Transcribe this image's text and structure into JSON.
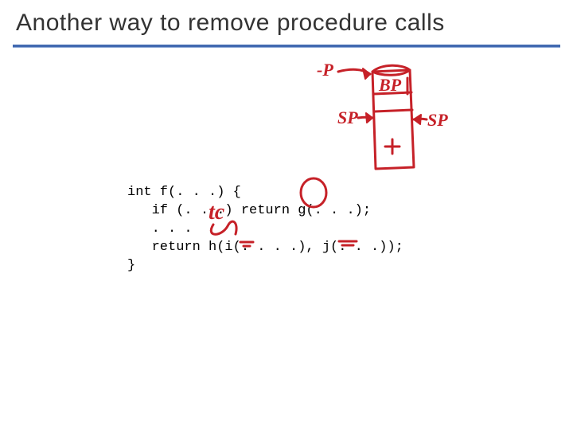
{
  "slide": {
    "title": "Another way to remove procedure calls",
    "code_lines": [
      "int f(. . .) {",
      "   if (. . .) return g(. . .);",
      "   . . .",
      "   return h(i(. . . .), j(. . .));",
      "}"
    ],
    "annotations": {
      "bp_label": "BP",
      "sp_label_left": "SP",
      "sp_label_right": "SP",
      "p_label": "-P",
      "tc_label": "tc",
      "stack_label": "",
      "circled": "g",
      "underline1": "h",
      "underline2": "j"
    }
  },
  "chart_data": {
    "type": "table",
    "description": "Code snippet on slide",
    "rows": [
      "int f(. . .) {",
      "   if (. . .) return g(. . .);",
      "   . . .",
      "   return h(i(. . . .), j(. . .));",
      "}"
    ]
  }
}
